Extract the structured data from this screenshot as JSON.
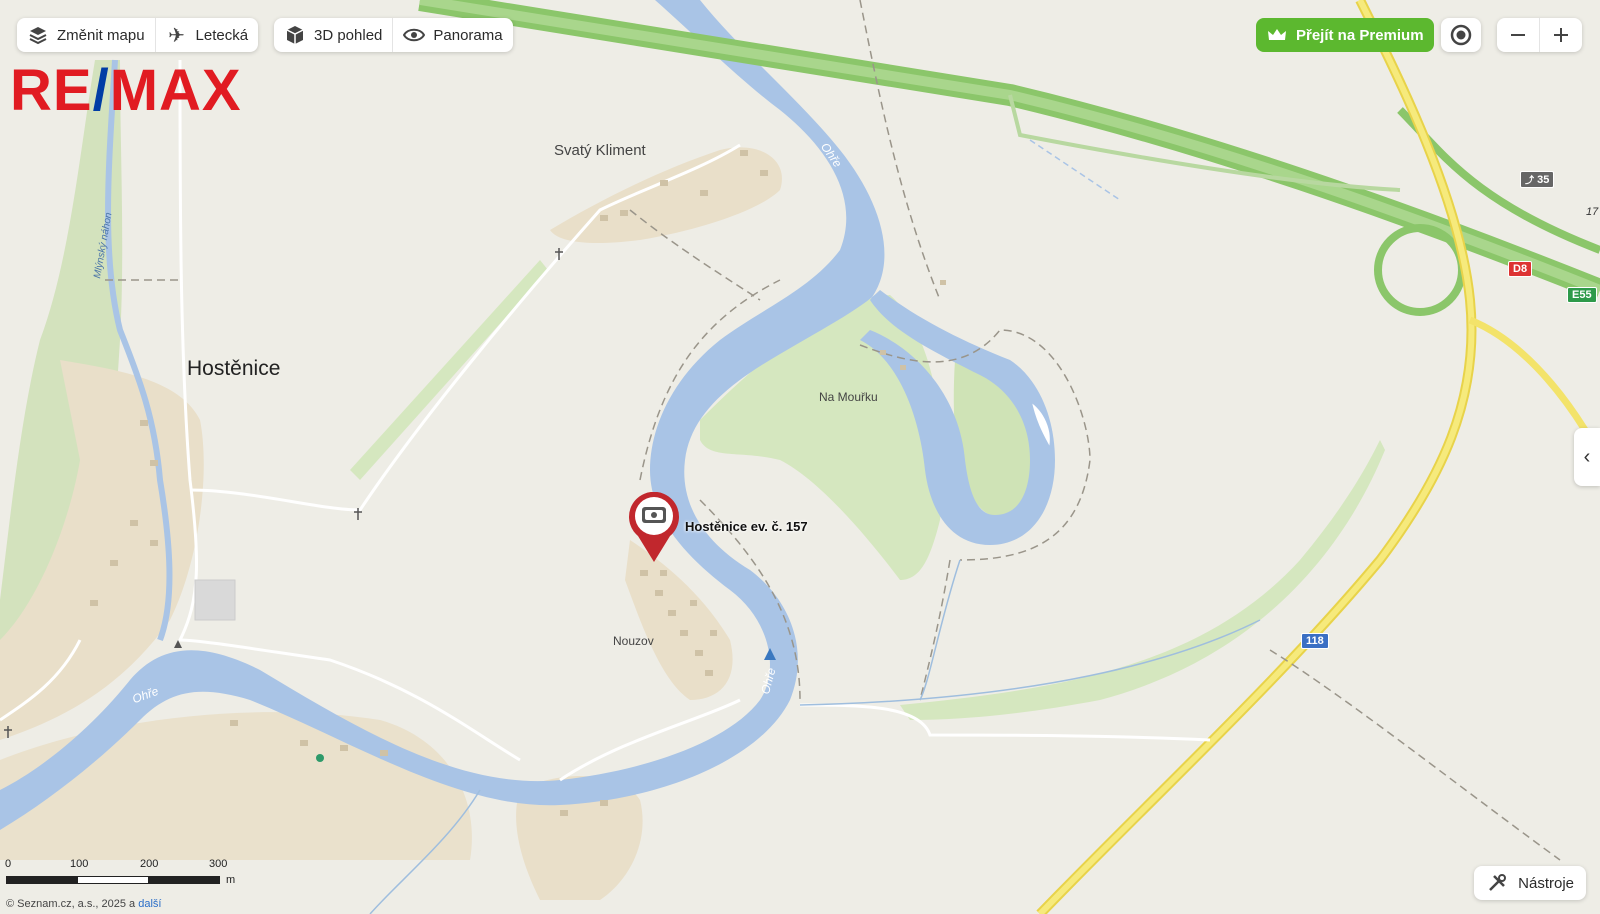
{
  "toolbar": {
    "change_map": "Změnit mapu",
    "aerial": "Letecká",
    "view_3d": "3D pohled",
    "panorama": "Panorama"
  },
  "premium": {
    "label": "Přejít na Premium",
    "color": "#5cb82f"
  },
  "logo": {
    "text": "RE/MAX",
    "red": "#e11b22",
    "blue": "#003da5"
  },
  "map": {
    "labels": {
      "hostenice": "Hostěnice",
      "svaty_kliment": "Svatý Kliment",
      "na_mourku": "Na Mouřku",
      "nouzov": "Nouzov",
      "ohre_1": "Ohře",
      "ohre_2": "Ohře",
      "ohre_3": "Ohře",
      "mlynsky_nahon": "Mlýnský náhon"
    },
    "marker": {
      "label": "Hostěnice ev. č. 157"
    },
    "road_shields": {
      "exit": "35",
      "d8": "D8",
      "e55": "E55",
      "r118": "118",
      "cut": "17"
    },
    "colors": {
      "water": "#a9c4e6",
      "green": "#d5e7bf",
      "motorway": "#8bc66a",
      "main_road": "#f3e36a",
      "settlement": "#e9dfc9"
    }
  },
  "scale_bar": {
    "ticks": [
      "0",
      "100",
      "200",
      "300"
    ],
    "unit": "m"
  },
  "copyright": {
    "prefix": "© Seznam.cz, a.s., 2025 a",
    "link": "další"
  },
  "tools": {
    "label": "Nástroje"
  },
  "icons": [
    "layers-icon",
    "plane-icon",
    "cube-icon",
    "eye-icon",
    "crown-icon",
    "locate-icon",
    "zoom-out-icon",
    "zoom-in-icon",
    "tools-icon",
    "chevron-left-icon",
    "photo-icon"
  ]
}
